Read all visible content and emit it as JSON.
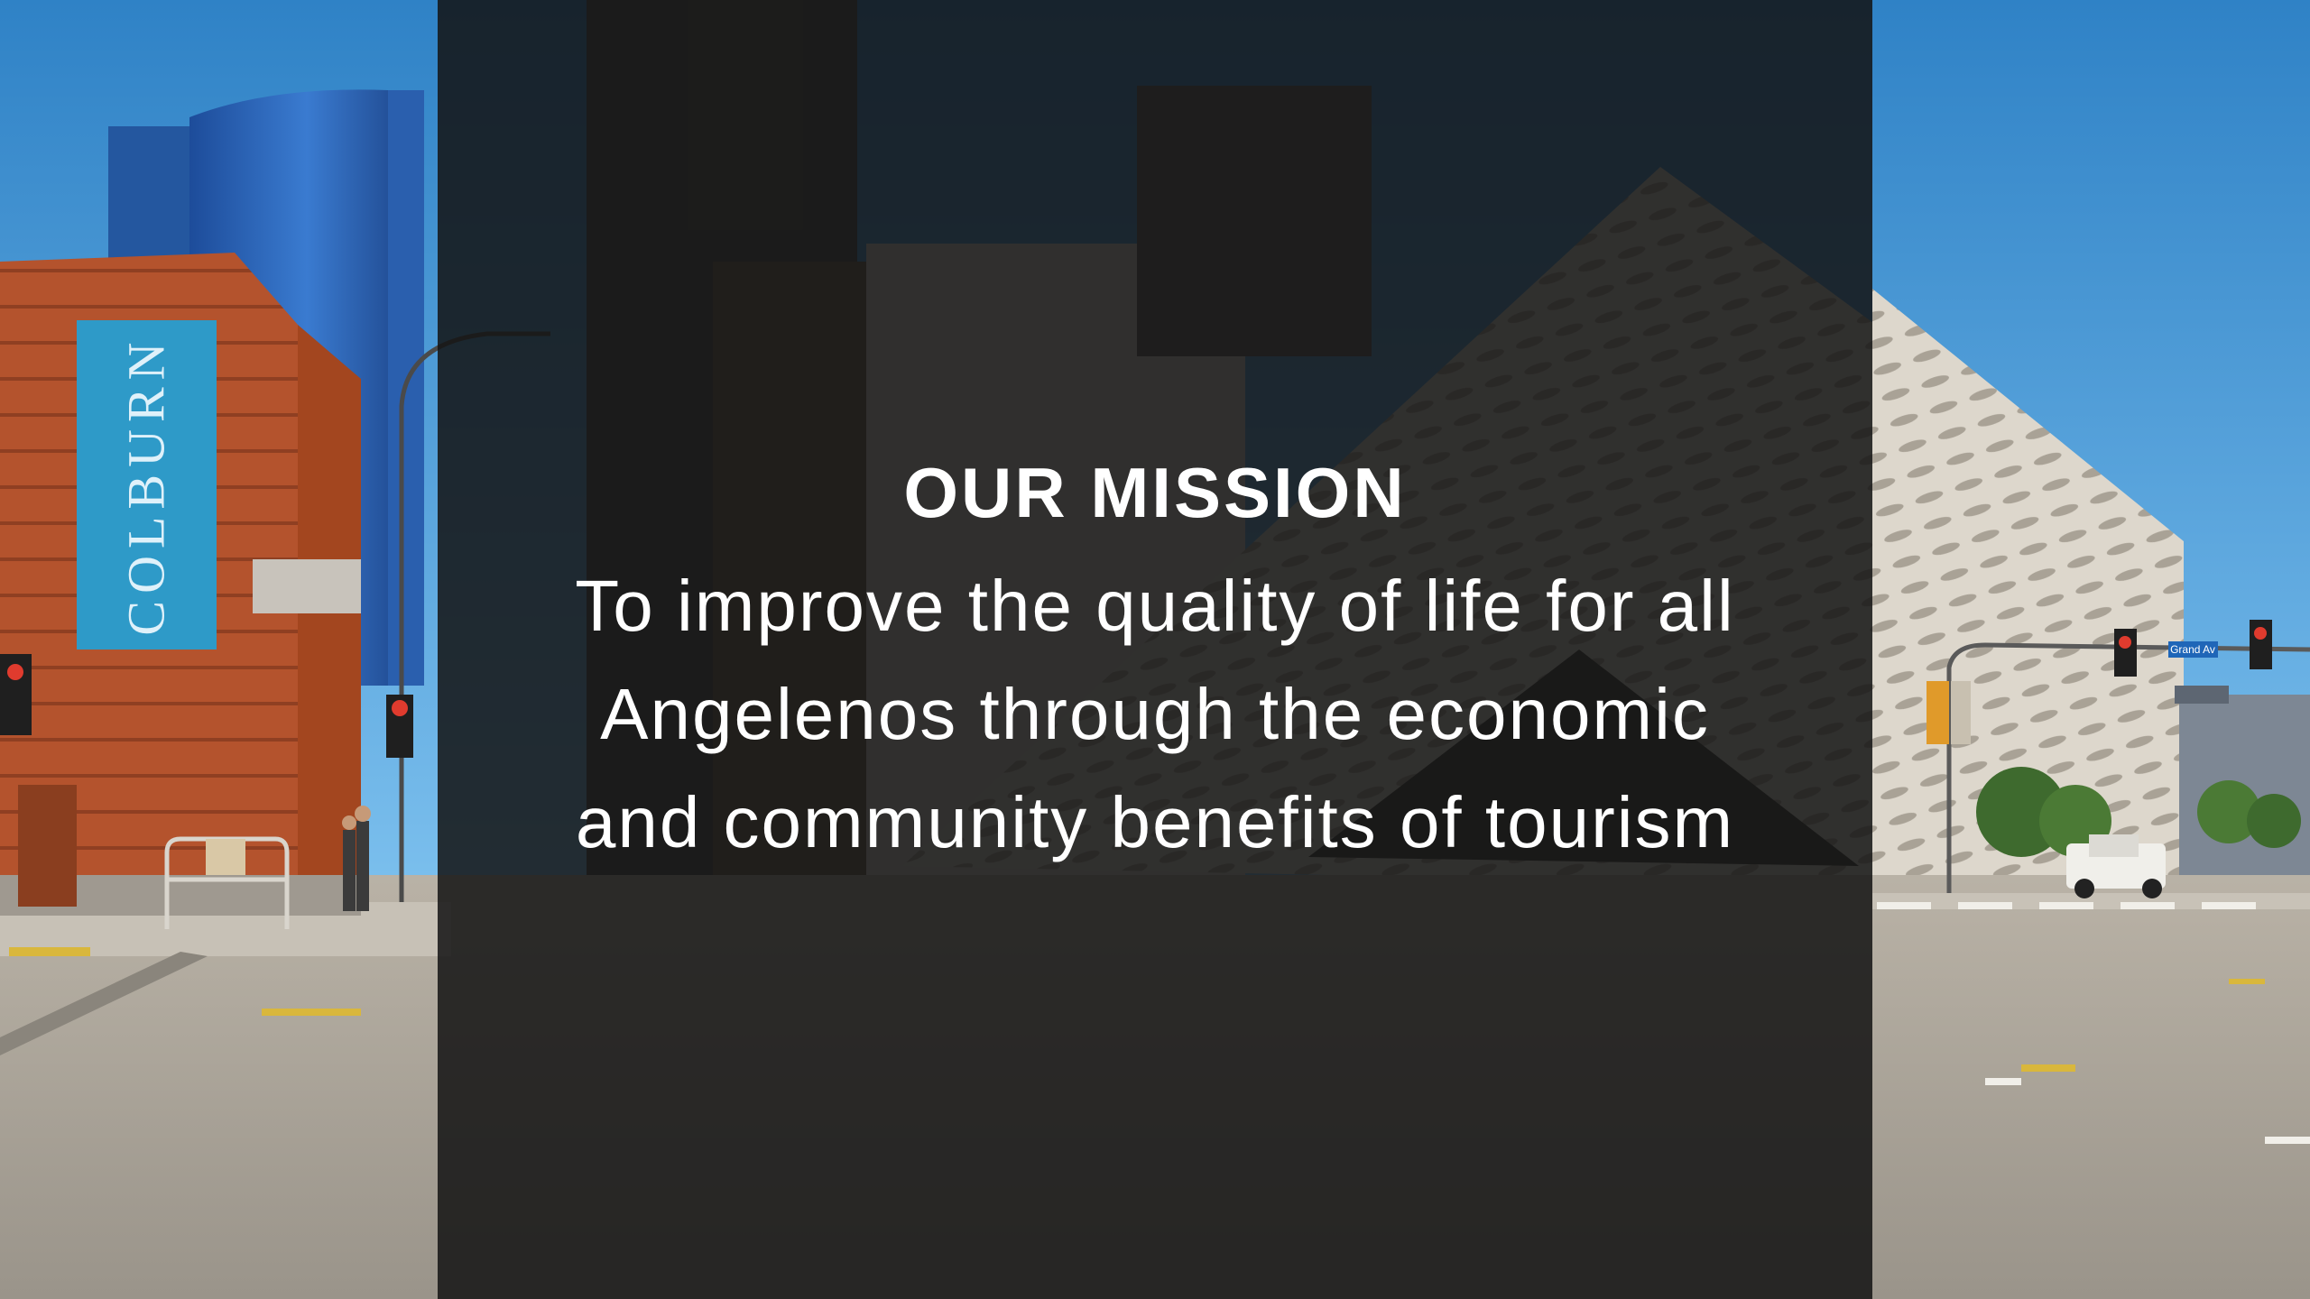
{
  "banner": {
    "building_sign": "COLBURN",
    "street_sign": "Grand Av"
  },
  "mission": {
    "heading": "OUR MISSION",
    "lines": [
      "To improve the quality of life for all",
      "Angelenos through the economic",
      "and community benefits of tourism"
    ]
  },
  "colors": {
    "sky": "#3f8fcf",
    "overlay": "#141414",
    "text": "#ffffff",
    "brick": "#a24a2a",
    "sign_blue": "#2e9ac8"
  }
}
